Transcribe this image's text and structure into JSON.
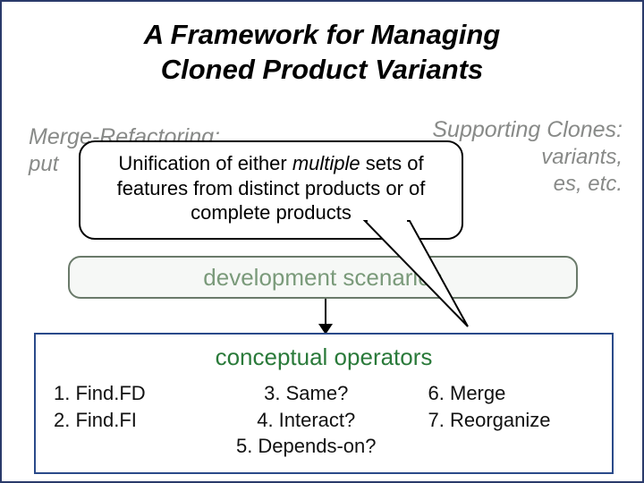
{
  "title_line1": "A Framework for Managing",
  "title_line2": "Cloned Product Variants",
  "clouds": {
    "left": {
      "title": "Merge-Refactoring:",
      "sub": "put"
    },
    "right": {
      "title": "Supporting Clones:",
      "sub_line1": "variants,",
      "sub_line2": "es, etc."
    }
  },
  "bubble": {
    "pre": "Unification of either ",
    "em": "multiple",
    "post1": " sets of",
    "line2": "features from distinct products or of",
    "line3": "complete products"
  },
  "dev_bar": "development scenarios",
  "ops": {
    "title": "conceptual operators",
    "col1": {
      "a": "1. Find.FD",
      "b": "2. Find.FI"
    },
    "col2": {
      "a": "3. Same?",
      "b": "4. Interact?",
      "c": "5. Depends-on?"
    },
    "col3": {
      "a": "6. Merge",
      "b": "7. Reorganize"
    }
  }
}
